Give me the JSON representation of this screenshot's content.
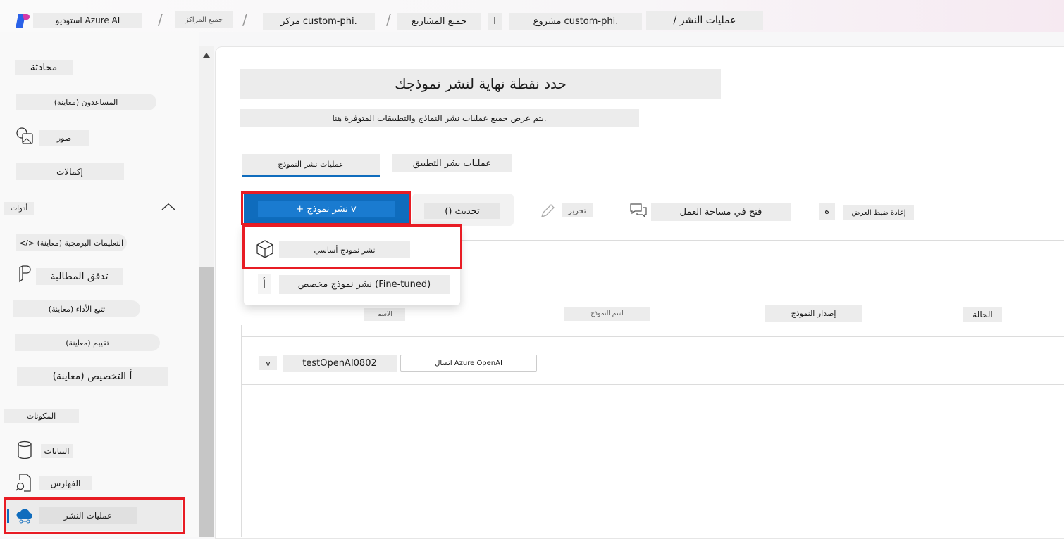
{
  "breadcrumb": {
    "studio": "استوديو Azure AI",
    "all_hubs": "جميع المراكز",
    "hub": "مركز custom-phi.",
    "all_projects": "جميع المشاريع",
    "sep_char": "ا",
    "project": "مشروع custom-phi.",
    "current": "/ عمليات النشر",
    "slash": "/"
  },
  "sidebar": {
    "chat": "محادثة",
    "assistants": "المساعدون (معاينة)",
    "images": "صور",
    "completions": "إكمالات",
    "tools_header": "أدوات",
    "code": "</> التعليمات البرمجية (معاينة)",
    "prompt_flow": "تدفق المطالبة",
    "tracing": "تتبع الأداء (معاينة)",
    "evaluation": "تقييم (معاينة)",
    "fine_tuning": "أ التخصيص (معاينة)",
    "components_header": "المكونات",
    "data": "البيانات",
    "indexes": "الفهارس",
    "deployments": "عمليات النشر"
  },
  "main": {
    "title": "حدد نقطة نهاية لنشر نموذجك",
    "subtitle": "يتم عرض جميع عمليات نشر النماذج والتطبيقات المتوفرة هنا.",
    "tabs": [
      {
        "label": "عمليات نشر النموذج",
        "active": true
      },
      {
        "label": "عمليات نشر التطبيق",
        "active": false
      }
    ],
    "toolbar": {
      "deploy": "+ نشر نموذج v",
      "refresh": "() تحديث",
      "edit": "تحرير",
      "open_workspace": "فتح في مساحة العمل",
      "reset_count": "ه",
      "reset_view": "إعادة ضبط العرض"
    },
    "dropdown": {
      "base": "نشر نموذج أساسي",
      "fine_tuned_icon": "أ",
      "fine_tuned": "نشر نموذج مخصص (Fine-tuned)"
    },
    "columns": [
      "الاسم",
      "اسم النموذج",
      "إصدار النموذج",
      "الحالة"
    ],
    "rows": [
      {
        "chevron": "v",
        "name": "testOpenAI0802",
        "connection": "اتصال Azure OpenAI"
      }
    ]
  },
  "colors": {
    "accent": "#0f6cbd",
    "highlight": "#e81c24"
  }
}
